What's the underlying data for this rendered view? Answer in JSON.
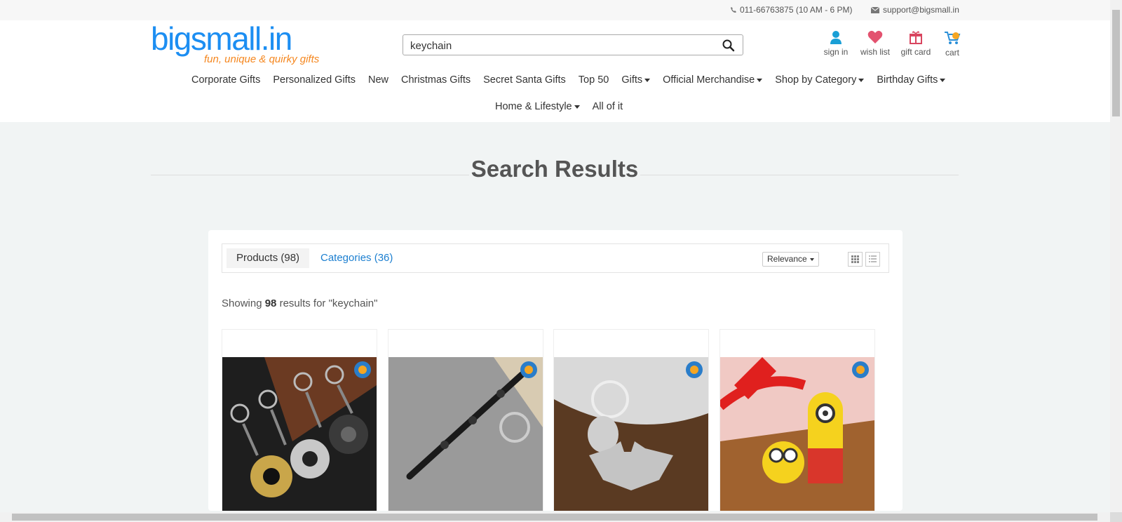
{
  "topbar": {
    "phone": "011-66763875 (10 AM - 6 PM)",
    "email": "support@bigsmall.in"
  },
  "header": {
    "logo_brand": "bigsmall.in",
    "logo_tagline": "fun, unique & quirky gifts",
    "search_value": "keychain",
    "icons": {
      "sign_in": "sign in",
      "wish_list": "wish list",
      "gift_card": "gift card",
      "cart": "cart"
    }
  },
  "nav": {
    "row1": [
      "Corporate Gifts",
      "Personalized Gifts",
      "New",
      "Christmas Gifts",
      "Secret Santa Gifts",
      "Top 50",
      "Gifts",
      "Official Merchandise",
      "Shop by Category",
      "Birthday Gifts"
    ],
    "row2": [
      "Home & Lifestyle",
      "All of it"
    ]
  },
  "page_title": "Search Results",
  "tabs": {
    "products": "Products (98)",
    "categories": "Categories (36)"
  },
  "sort_label": "Relevance",
  "results": {
    "prefix": "Showing",
    "count": "98",
    "suffix": "results for \"keychain\""
  },
  "products": [
    {
      "image": "frying-pan-keychains"
    },
    {
      "image": "wand-keychain"
    },
    {
      "image": "batman-keychain"
    },
    {
      "image": "minion-keychain"
    }
  ],
  "colors": {
    "brand_blue": "#1c8ef2",
    "brand_orange": "#f5871f",
    "link_blue": "#1c7fd0"
  }
}
